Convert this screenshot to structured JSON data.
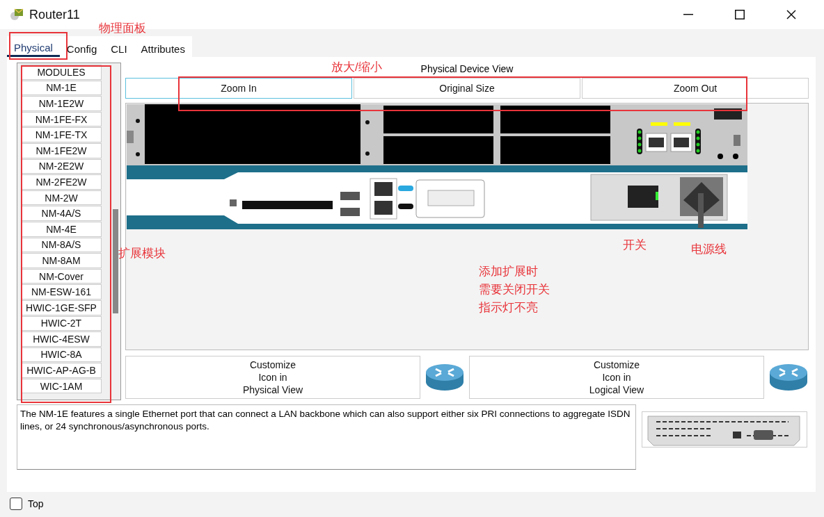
{
  "window": {
    "title": "Router11"
  },
  "tabs": [
    {
      "label": "Physical",
      "selected": true
    },
    {
      "label": "Config",
      "selected": false
    },
    {
      "label": "CLI",
      "selected": false
    },
    {
      "label": "Attributes",
      "selected": false
    }
  ],
  "modules": {
    "header": "MODULES",
    "items": [
      "NM-1E",
      "NM-1E2W",
      "NM-1FE-FX",
      "NM-1FE-TX",
      "NM-1FE2W",
      "NM-2E2W",
      "NM-2FE2W",
      "NM-2W",
      "NM-4A/S",
      "NM-4E",
      "NM-8A/S",
      "NM-8AM",
      "NM-Cover",
      "NM-ESW-161",
      "HWIC-1GE-SFP",
      "HWIC-2T",
      "HWIC-4ESW",
      "HWIC-8A",
      "HWIC-AP-AG-B",
      "WIC-1AM"
    ]
  },
  "device_view": {
    "title": "Physical Device View",
    "zoom_buttons": [
      {
        "label": "Zoom In",
        "selected": true
      },
      {
        "label": "Original Size",
        "selected": false
      },
      {
        "label": "Zoom Out",
        "selected": false
      }
    ]
  },
  "customize_buttons": [
    "Customize\nIcon in\nPhysical View",
    "Customize\nIcon in\nLogical View"
  ],
  "description": "The NM-1E features a single Ethernet port that can connect a LAN backbone which can also support either six PRI connections to aggregate ISDN lines, or 24 synchronous/asynchronous ports.",
  "top_checkbox": {
    "label": "Top",
    "checked": false
  },
  "annotations": [
    "物理面板",
    "放大/缩小",
    "扩展模块",
    "开关",
    "电源线",
    "添加扩展时",
    "需要关闭开关",
    "指示灯不亮"
  ]
}
